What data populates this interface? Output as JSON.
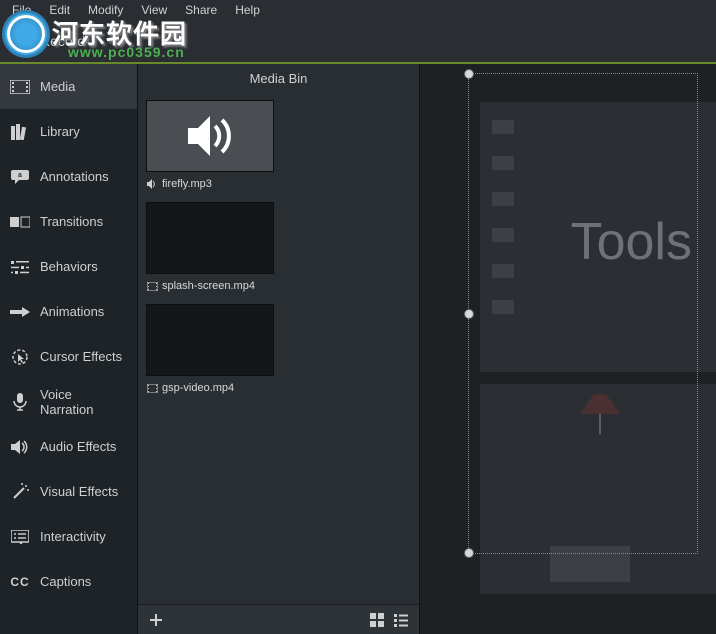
{
  "menubar": [
    "File",
    "Edit",
    "Modify",
    "View",
    "Share",
    "Help"
  ],
  "watermark": {
    "cn": "河东软件园",
    "url": "www.pc0359.cn"
  },
  "record": {
    "label": "Record"
  },
  "sidebar": {
    "items": [
      {
        "label": "Media",
        "icon": "filmstrip-icon",
        "active": true
      },
      {
        "label": "Library",
        "icon": "books-icon",
        "active": false
      },
      {
        "label": "Annotations",
        "icon": "callout-icon",
        "active": false
      },
      {
        "label": "Transitions",
        "icon": "transition-icon",
        "active": false
      },
      {
        "label": "Behaviors",
        "icon": "sliders-icon",
        "active": false
      },
      {
        "label": "Animations",
        "icon": "arrow-icon",
        "active": false
      },
      {
        "label": "Cursor Effects",
        "icon": "cursor-icon",
        "active": false
      },
      {
        "label": "Voice Narration",
        "icon": "microphone-icon",
        "active": false
      },
      {
        "label": "Audio Effects",
        "icon": "speaker-icon",
        "active": false
      },
      {
        "label": "Visual Effects",
        "icon": "wand-icon",
        "active": false
      },
      {
        "label": "Interactivity",
        "icon": "quiz-icon",
        "active": false
      },
      {
        "label": "Captions",
        "icon": "cc-icon",
        "active": false
      }
    ]
  },
  "mediabin": {
    "title": "Media Bin",
    "items": [
      {
        "name": "firefly.mp3",
        "type": "audio"
      },
      {
        "name": "splash-screen.mp4",
        "type": "video"
      },
      {
        "name": "gsp-video.mp4",
        "type": "video"
      }
    ]
  },
  "canvas": {
    "preview_text": "Tools"
  }
}
